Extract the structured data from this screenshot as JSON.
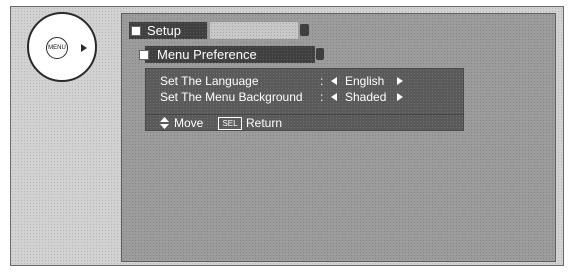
{
  "remote": {
    "menu_button_label": "MENU"
  },
  "osd": {
    "tab_title": "Setup",
    "menu_title": "Menu Preference",
    "rows": [
      {
        "label": "Set The Language",
        "colon": ":",
        "value": "English"
      },
      {
        "label": "Set The Menu Background",
        "colon": ":",
        "value": "Shaded"
      }
    ],
    "footer": {
      "move_label": "Move",
      "sel_key": "SEL",
      "return_label": "Return"
    }
  },
  "icons": {
    "remote_right_arrow": "arrow-right-icon",
    "row_left_arrow": "left-arrow-icon",
    "row_right_arrow": "right-arrow-icon",
    "updown": "up-down-icon"
  },
  "colors": {
    "screen_bg": "#9c9c9c",
    "bar_dark": "#3f3f3f",
    "panel_bg": "#5a5a5a",
    "text": "#ffffff"
  }
}
